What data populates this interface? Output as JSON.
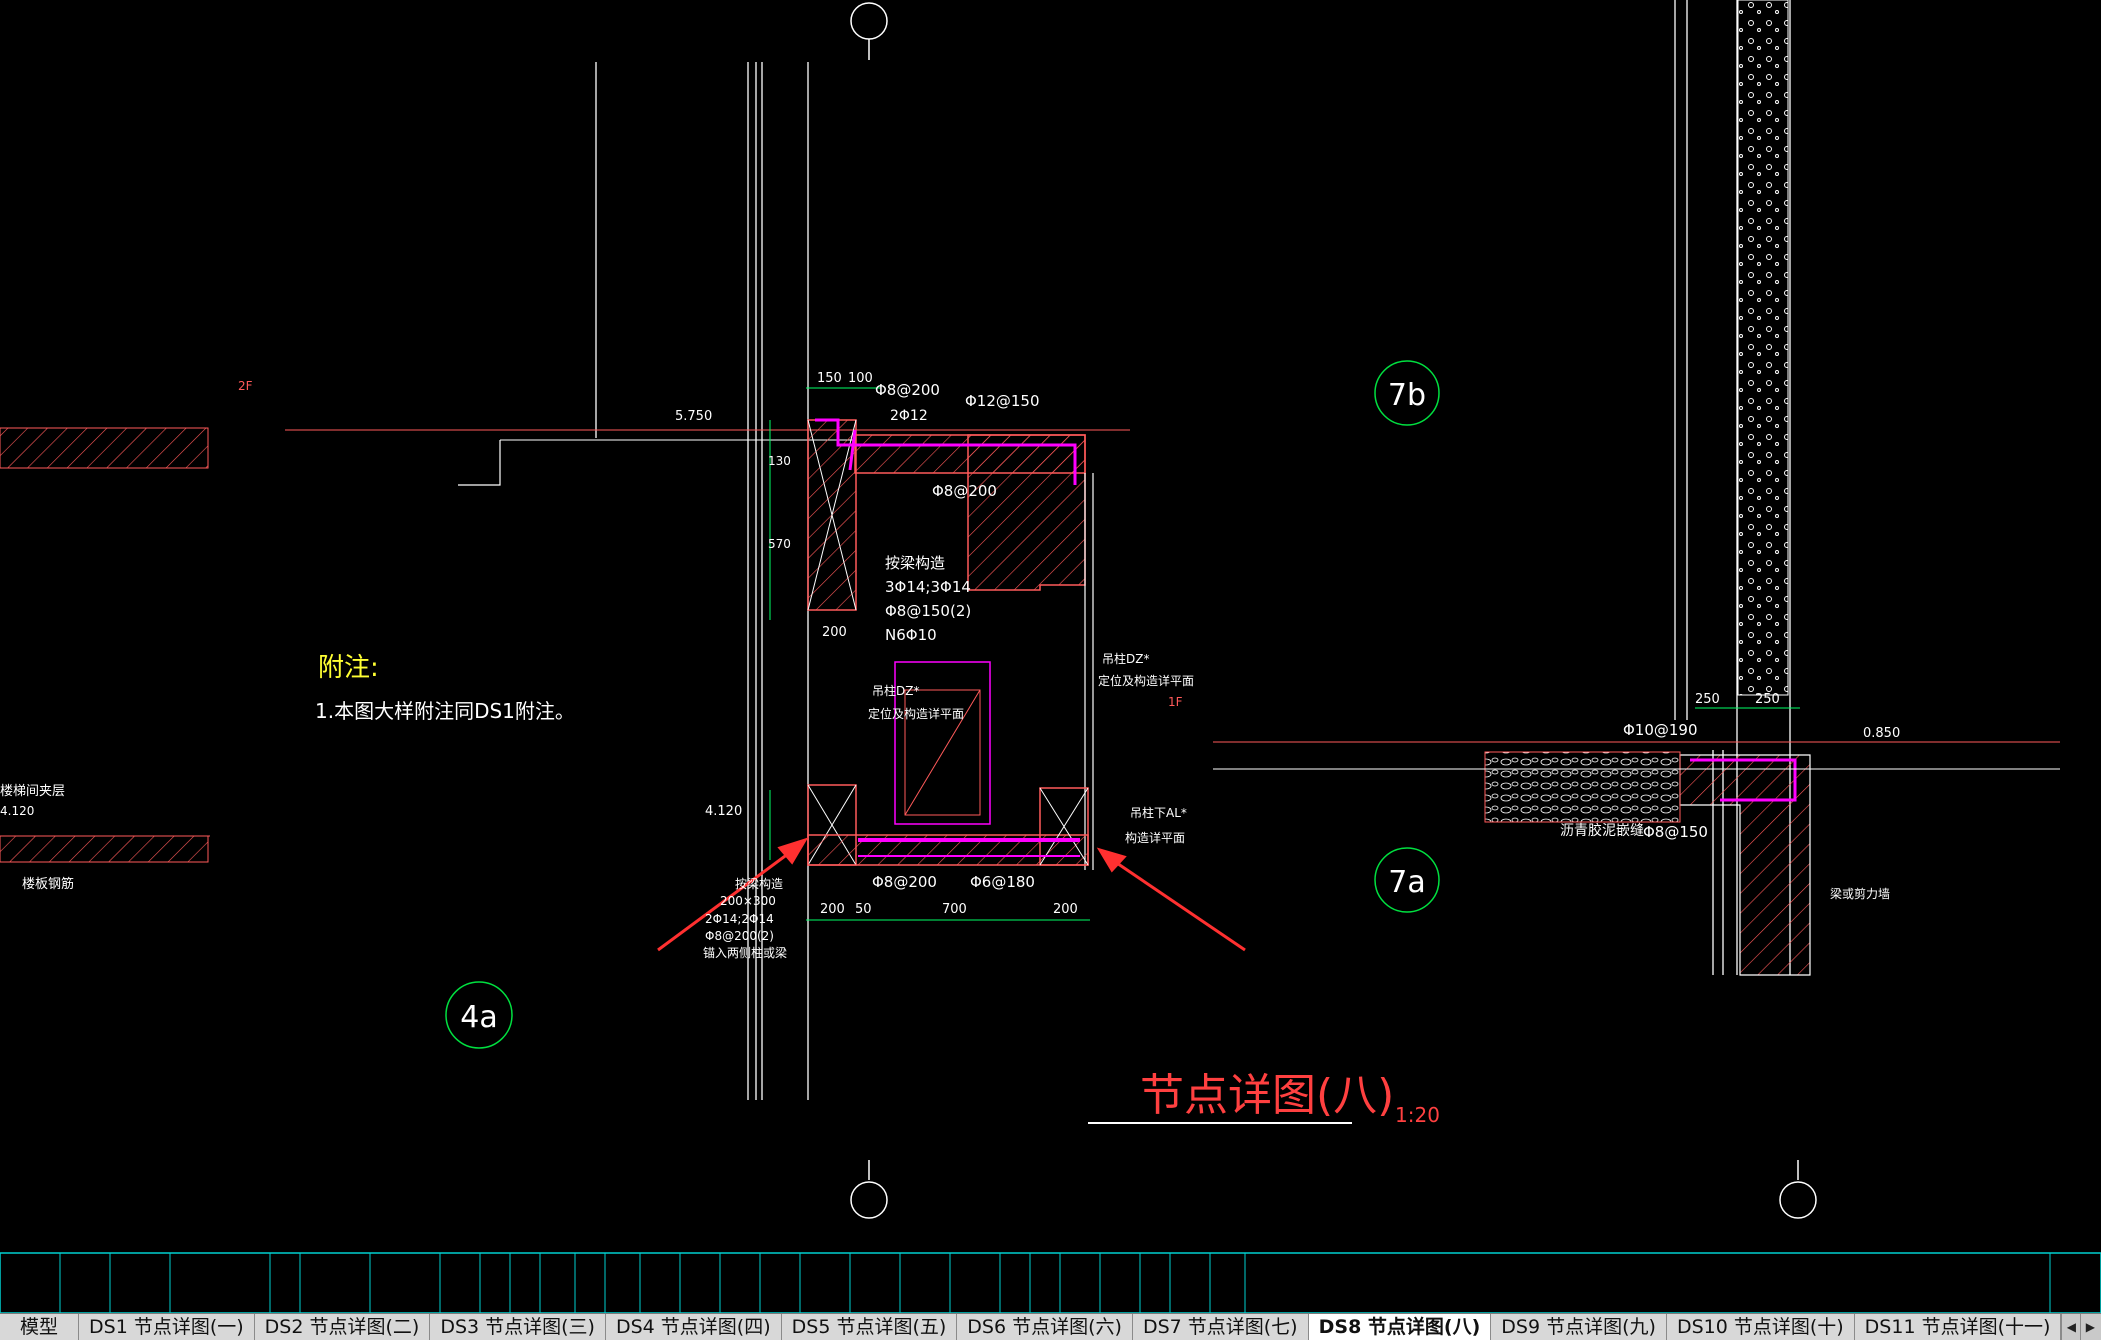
{
  "drawing": {
    "title": "节点详图(八)",
    "scale": "1:20",
    "note_heading": "附注:",
    "note_line": "1.本图大样附注同DS1附注。",
    "detail_markers": [
      "7b",
      "7a",
      "4a"
    ],
    "elevations": [
      "5.750",
      "4.120",
      "0.850"
    ],
    "labels": {
      "floor_2f": "2F",
      "floor_1f": "1F",
      "dim_150": "150",
      "dim_100": "100",
      "rebar_top": "Φ8@200",
      "rebar_2phi12": "2Φ12",
      "rebar_phi12_150": "Φ12@150",
      "rebar_inner": "Φ8@200",
      "beam_title": "按梁构造",
      "beam_rebar1": "3Φ14;3Φ14",
      "beam_rebar2": "Φ8@150(2)",
      "beam_rebar3": "N6Φ10",
      "dim_200": "200",
      "dim_570": "570",
      "dim_130": "130",
      "dz_label1": "吊柱DZ*",
      "dz_label2": "定位及构造详平面",
      "dz_label3": "吊柱DZ*",
      "dz_label4": "定位及构造详平面",
      "al_label1": "吊柱下AL*",
      "al_label2": "构造详平面",
      "bottom_beam1": "按梁构造",
      "bottom_beam2": "200×300",
      "bottom_beam3": "2Φ14;2Φ14",
      "bottom_beam4": "Φ8@200(2)",
      "bottom_beam5": "锚入两侧柱或梁",
      "bottom_rebar1": "Φ8@200",
      "bottom_rebar2": "Φ6@180",
      "dim_bottom": [
        "200",
        "50",
        "700",
        "200"
      ],
      "right_dim": [
        "250",
        "250"
      ],
      "right_rebar1": "Φ10@190",
      "right_rebar2": "Φ8@150",
      "right_label1": "沥青胶泥嵌缝",
      "right_label2": "梁或剪力墙",
      "left_label1": "楼梯间夹层",
      "left_label2": "楼板钢筋",
      "left_elev": "4.120",
      "left_top": "2F"
    }
  },
  "tabs": [
    {
      "label": "模型",
      "active": false
    },
    {
      "label": "DS1 节点详图(一)",
      "active": false
    },
    {
      "label": "DS2 节点详图(二)",
      "active": false
    },
    {
      "label": "DS3 节点详图(三)",
      "active": false
    },
    {
      "label": "DS4 节点详图(四)",
      "active": false
    },
    {
      "label": "DS5 节点详图(五)",
      "active": false
    },
    {
      "label": "DS6 节点详图(六)",
      "active": false
    },
    {
      "label": "DS7 节点详图(七)",
      "active": false
    },
    {
      "label": "DS8 节点详图(八)",
      "active": true
    },
    {
      "label": "DS9 节点详图(九)",
      "active": false
    },
    {
      "label": "DS10 节点详图(十)",
      "active": false
    },
    {
      "label": "DS11 节点详图(十一)",
      "active": false
    }
  ],
  "colors": {
    "grid_line": "#ffffff",
    "section_red": "#ff5a5a",
    "rebar_magenta": "#ff00ff",
    "dim_green": "#00ff66",
    "marker_green": "#00e040",
    "title_red": "#ff4040",
    "note_yellow": "#ffff33",
    "titleblock_cyan": "#00d0d0"
  }
}
